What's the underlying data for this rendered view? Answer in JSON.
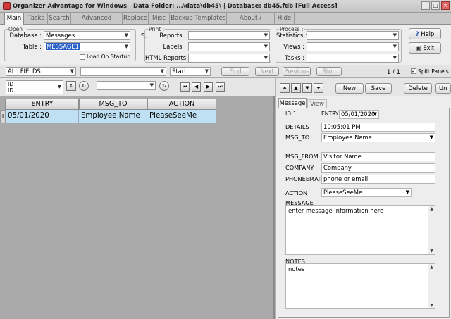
{
  "window": {
    "title": "Organizer Advantage for Windows | Data Folder: ...\\data\\db45\\ | Database: db45.fdb [Full Access]"
  },
  "tabs": [
    "Main",
    "Tasks",
    "Search",
    "Advanced Search",
    "Replace",
    "Misc",
    "Backup",
    "Templates",
    "About / Upgrade",
    "Hide"
  ],
  "open_group": {
    "title": "Open :",
    "database_label": "Database :",
    "database_value": "Messages",
    "table_label": "Table :",
    "table_value": "MESSAGE1",
    "load_on_startup_label": "Load On Startup"
  },
  "print_group": {
    "title": "Print :",
    "reports_label": "Reports :",
    "labels_label": "Labels :",
    "html_reports_label": "HTML Reports :"
  },
  "process_group": {
    "title": "Process :",
    "statistics_label": "Statistics :",
    "views_label": "Views :",
    "tasks_label": "Tasks :"
  },
  "help_label": "Help",
  "exit_label": "Exit",
  "find_bar": {
    "field_select": "ALL FIELDS",
    "match_select": "Start",
    "find_label": "Find",
    "next_label": "Next",
    "previous_label": "Previous",
    "stop_label": "Stop",
    "record_count": "1 / 1",
    "split_panels_label": "Split Panels"
  },
  "sort_bar": {
    "sort_field": "ID",
    "sort_field_sub": "ID",
    "sort_arrow": "↕",
    "refresh": "↻"
  },
  "grid": {
    "columns": [
      "ENTRY",
      "MSG_TO",
      "ACTION"
    ],
    "rows": [
      [
        "05/01/2020",
        "Employee Name",
        "PleaseSeeMe"
      ]
    ],
    "row_marker": "I"
  },
  "record_panel": {
    "new_label": "New",
    "save_label": "Save",
    "delete_label": "Delete",
    "undo_label": "Un",
    "tabs": [
      "Message",
      "View"
    ],
    "id_label": "ID",
    "id_value": "1",
    "entry_label": "ENTRY",
    "entry_value": "05/01/2020",
    "details_label": "DETAILS",
    "details_value": "10:05:01 PM",
    "msg_to_label": "MSG_TO",
    "msg_to_value": "Employee Name",
    "msg_from_label": "MSG_FROM",
    "msg_from_value": "Visitor Name",
    "company_label": "COMPANY",
    "company_value": "Company",
    "phoneemail_label": "PHONEEMAIL",
    "phoneemail_value": "phone or email",
    "action_label": "ACTION",
    "action_value": "PleaseSeeMe",
    "message_label": "MESSAGE",
    "message_value": "enter message information here",
    "notes_label": "NOTES",
    "notes_value": "notes"
  }
}
